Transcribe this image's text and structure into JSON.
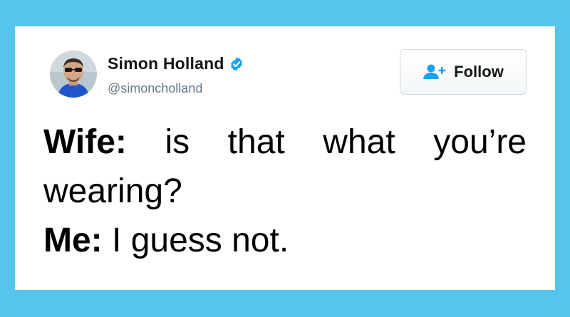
{
  "user": {
    "display_name": "Simon Holland",
    "handle": "@simoncholland",
    "verified": true
  },
  "follow_button": {
    "label": "Follow",
    "icon": "add-user-icon"
  },
  "tweet": {
    "lines": [
      {
        "speaker": "Wife:",
        "text": "is that what you’re"
      },
      {
        "speaker": "",
        "text": "wearing?"
      },
      {
        "speaker": "Me:",
        "text": "I guess not."
      }
    ]
  },
  "colors": {
    "background": "#55c5ec",
    "card": "#ffffff",
    "verified_badge": "#1da1f2",
    "follow_icon": "#1da1f2",
    "handle_text": "#657786"
  }
}
